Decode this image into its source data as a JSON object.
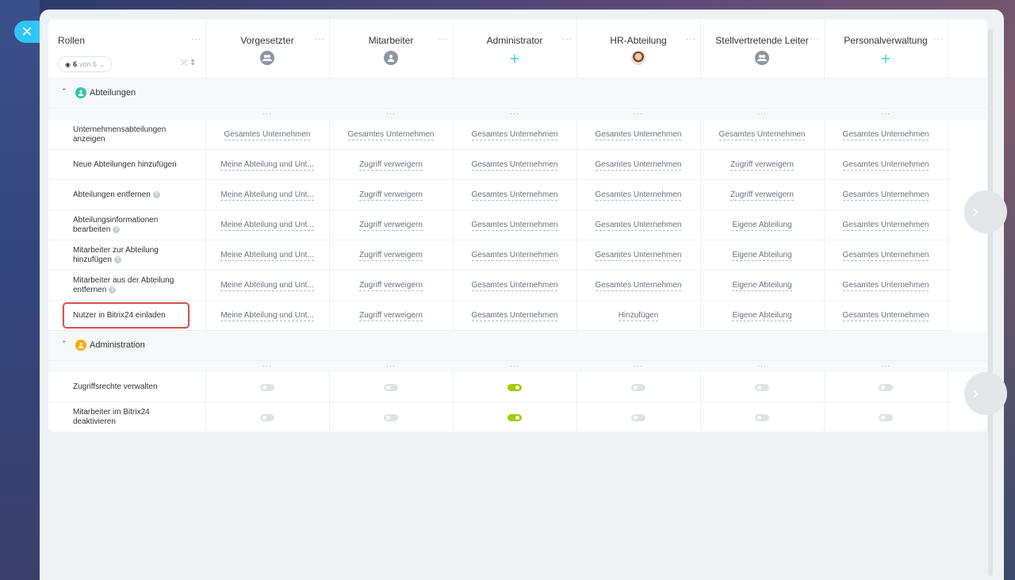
{
  "roles_header": {
    "title": "Rollen",
    "filter_count": "6",
    "filter_total": "von 6"
  },
  "roles": [
    {
      "name": "Vorgesetzter",
      "icon": "group-icon"
    },
    {
      "name": "Mitarbeiter",
      "icon": "user-icon"
    },
    {
      "name": "Administrator",
      "icon": "plus-icon"
    },
    {
      "name": "HR-Abteilung",
      "icon": "avatar"
    },
    {
      "name": "Stellvertretende Leiter",
      "icon": "group-icon"
    },
    {
      "name": "Personalverwaltung",
      "icon": "plus-icon"
    }
  ],
  "sections": [
    {
      "title": "Abteilungen",
      "rows": [
        {
          "label": "Unternehmensabteilungen anzeigen",
          "help": false,
          "values": [
            "Gesamtes Unternehmen",
            "Gesamtes Unternehmen",
            "Gesamtes Unternehmen",
            "Gesamtes Unternehmen",
            "Gesamtes Unternehmen",
            "Gesamtes Unternehmen"
          ]
        },
        {
          "label": "Neue Abteilungen hinzufügen",
          "help": false,
          "values": [
            "Meine Abteilung und Unt...",
            "Zugriff verweigern",
            "Gesamtes Unternehmen",
            "Gesamtes Unternehmen",
            "Zugriff verweigern",
            "Gesamtes Unternehmen"
          ]
        },
        {
          "label": "Abteilungen entfernen",
          "help": true,
          "values": [
            "Meine Abteilung und Unt...",
            "Zugriff verweigern",
            "Gesamtes Unternehmen",
            "Gesamtes Unternehmen",
            "Zugriff verweigern",
            "Gesamtes Unternehmen"
          ]
        },
        {
          "label": "Abteilungsinformationen bearbeiten",
          "help": true,
          "values": [
            "Meine Abteilung und Unt...",
            "Zugriff verweigern",
            "Gesamtes Unternehmen",
            "Gesamtes Unternehmen",
            "Eigene Abteilung",
            "Gesamtes Unternehmen"
          ]
        },
        {
          "label": "Mitarbeiter zur Abteilung hinzufügen",
          "help": true,
          "values": [
            "Meine Abteilung und Unt...",
            "Zugriff verweigern",
            "Gesamtes Unternehmen",
            "Gesamtes Unternehmen",
            "Eigene Abteilung",
            "Gesamtes Unternehmen"
          ]
        },
        {
          "label": "Mitarbeiter aus der Abteilung entfernen",
          "help": true,
          "values": [
            "Meine Abteilung und Unt...",
            "Zugriff verweigern",
            "Gesamtes Unternehmen",
            "Gesamtes Unternehmen",
            "Eigene Abteilung",
            "Gesamtes Unternehmen"
          ]
        },
        {
          "label": "Nutzer in Bitrix24 einladen",
          "help": false,
          "values": [
            "Meine Abteilung und Unt...",
            "Zugriff verweigern",
            "Gesamtes Unternehmen",
            "Hinzufügen",
            "Eigene Abteilung",
            "Gesamtes Unternehmen"
          ]
        }
      ]
    },
    {
      "title": "Administration",
      "rows": [
        {
          "label": "Zugriffsrechte verwalten",
          "toggles": [
            false,
            false,
            true,
            false,
            false,
            false
          ]
        },
        {
          "label": "Mitarbeiter im Bitrix24 deaktivieren",
          "toggles": [
            false,
            false,
            true,
            false,
            false,
            false
          ]
        }
      ]
    }
  ],
  "menu_dots": "···",
  "colors": {
    "accent": "#2fc6f6",
    "toggle_on": "#9dcf00",
    "highlight": "#d9534f"
  }
}
